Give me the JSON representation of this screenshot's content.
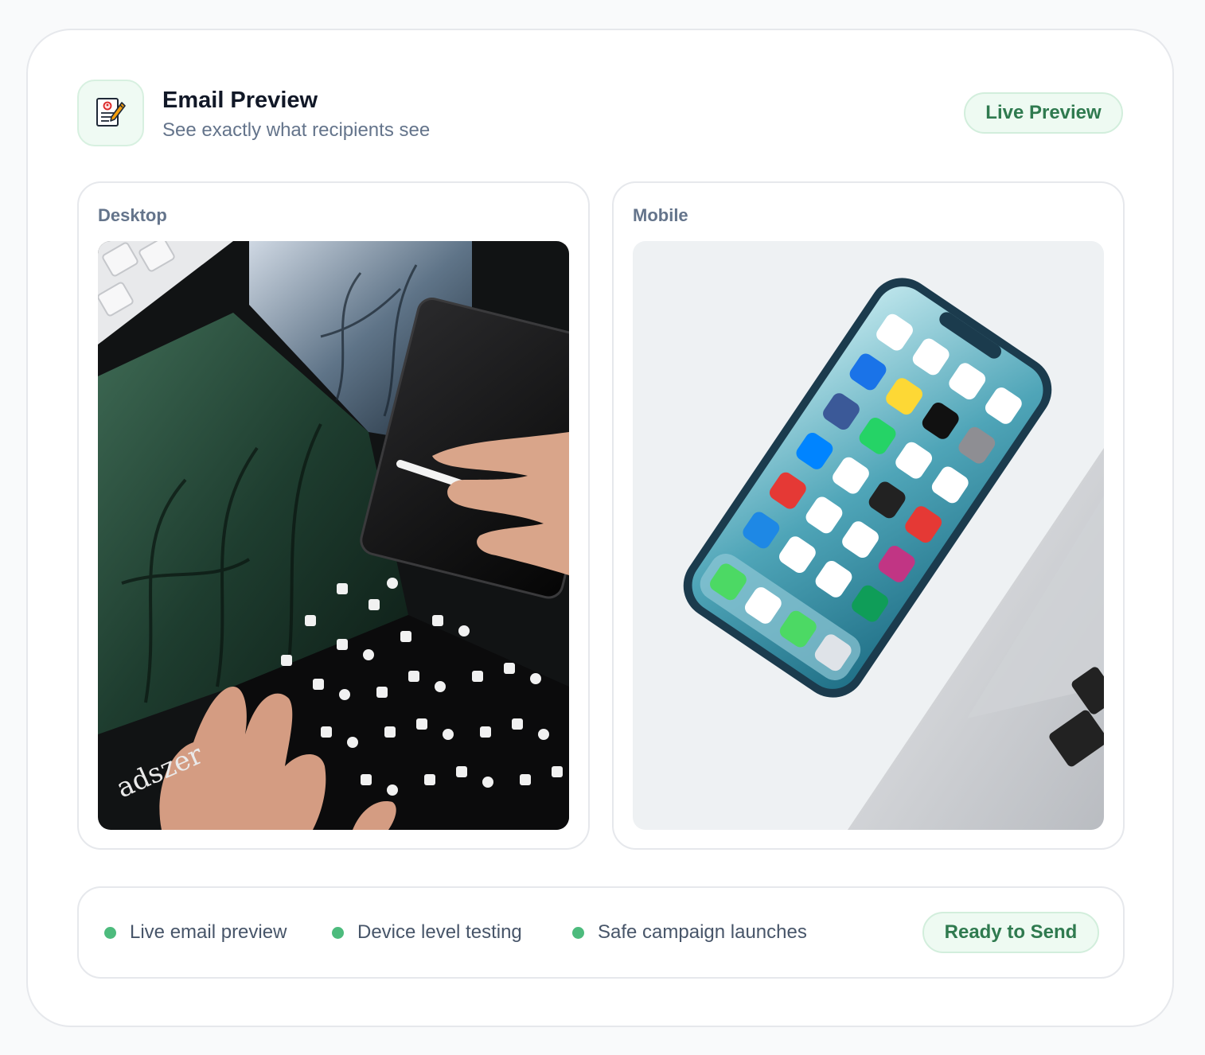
{
  "header": {
    "title": "Email Preview",
    "subtitle": "See exactly what recipients see",
    "badge": "Live Preview",
    "icon": "email-document-edit-icon"
  },
  "previews": {
    "desktop": {
      "label": "Desktop",
      "image": "tablet-stylus-photo"
    },
    "mobile": {
      "label": "Mobile",
      "image": "smartphone-homescreen-photo"
    }
  },
  "footer": {
    "features": [
      {
        "label": "Live email preview"
      },
      {
        "label": "Device level testing"
      },
      {
        "label": "Safe campaign launches"
      }
    ],
    "status": "Ready to Send"
  },
  "colors": {
    "accent_green": "#4dbb7d",
    "badge_text": "#2f7a4f",
    "badge_bg": "#eefaf2"
  }
}
